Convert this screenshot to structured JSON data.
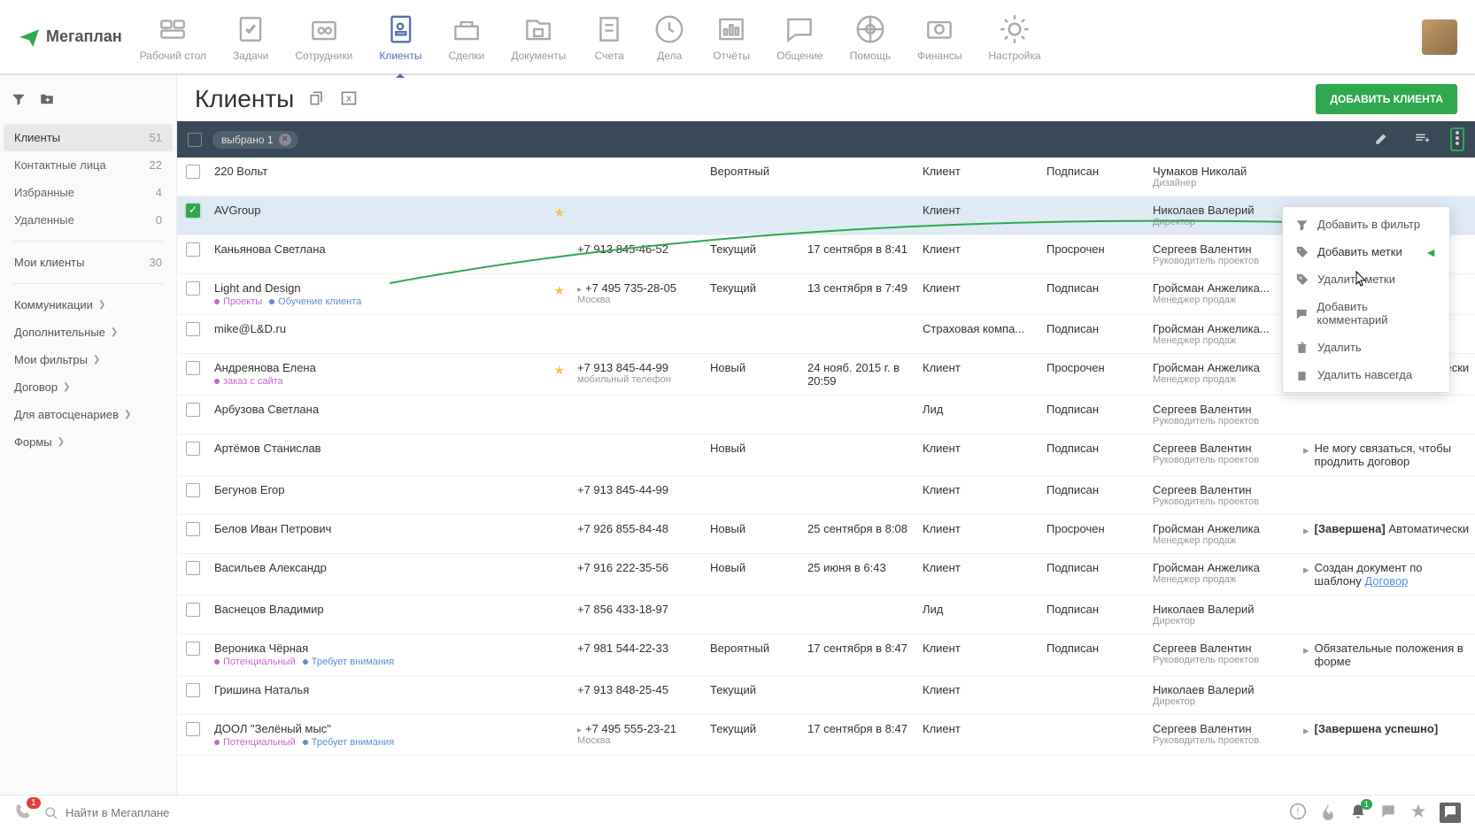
{
  "brand": "Мегаплан",
  "nav": [
    {
      "label": "Рабочий стол",
      "active": false
    },
    {
      "label": "Задачи",
      "active": false
    },
    {
      "label": "Сотрудники",
      "active": false
    },
    {
      "label": "Клиенты",
      "active": true
    },
    {
      "label": "Сделки",
      "active": false
    },
    {
      "label": "Документы",
      "active": false
    },
    {
      "label": "Счета",
      "active": false
    },
    {
      "label": "Дела",
      "active": false
    },
    {
      "label": "Отчёты",
      "active": false
    },
    {
      "label": "Общение",
      "active": false
    },
    {
      "label": "Помощь",
      "active": false
    },
    {
      "label": "Финансы",
      "active": false
    },
    {
      "label": "Настройка",
      "active": false
    }
  ],
  "sidebar": {
    "filters": [
      {
        "label": "Клиенты",
        "count": "51",
        "active": true
      },
      {
        "label": "Контактные лица",
        "count": "22",
        "active": false
      },
      {
        "label": "Избранные",
        "count": "4",
        "active": false
      },
      {
        "label": "Удаленные",
        "count": "0",
        "active": false
      }
    ],
    "sections": [
      {
        "label": "Мои клиенты",
        "count": "30"
      },
      {
        "label": "Коммуникации"
      },
      {
        "label": "Дополнительные"
      },
      {
        "label": "Мои фильтры"
      },
      {
        "label": "Договор"
      },
      {
        "label": "Для автосценариев"
      },
      {
        "label": "Формы"
      }
    ]
  },
  "page": {
    "title": "Клиенты",
    "add_button": "Добавить клиента"
  },
  "selection": {
    "chip_label": "выбрано 1"
  },
  "dropdown": {
    "items": [
      {
        "label": "Добавить в фильтр",
        "icon": "filter"
      },
      {
        "label": "Добавить метки",
        "icon": "tag",
        "highlight": true
      },
      {
        "label": "Удалить метки",
        "icon": "tag-remove"
      },
      {
        "label": "Добавить комментарий",
        "icon": "comment"
      },
      {
        "label": "Удалить",
        "icon": "trash"
      },
      {
        "label": "Удалить навсегда",
        "icon": "trash-x"
      }
    ]
  },
  "rows": [
    {
      "checked": false,
      "name": "220 Вольт",
      "star": false,
      "tags": [],
      "phone": "",
      "phonesub": "",
      "status": "Вероятный",
      "date": "",
      "type": "Клиент",
      "contract": "Подписан",
      "manager": "Чумаков Николай",
      "role": "Дизайнер",
      "extra": ""
    },
    {
      "checked": true,
      "name": "AVGroup",
      "star": true,
      "tags": [],
      "phone": "",
      "phonesub": "",
      "status": "",
      "date": "",
      "type": "Клиент",
      "contract": "",
      "manager": "Николаев Валерий",
      "role": "Директор",
      "extra": ""
    },
    {
      "checked": false,
      "name": "Каньянова Светлана",
      "star": false,
      "tags": [],
      "phone": "+7 913 845-46-52",
      "phonesub": "",
      "status": "Текущий",
      "date": "17 сентября в 8:41",
      "type": "Клиент",
      "contract": "Просрочен",
      "manager": "Сергеев Валентин",
      "role": "Руководитель проектов",
      "extra": ""
    },
    {
      "checked": false,
      "name": "Light and Design",
      "star": true,
      "tags": [
        {
          "color": "#c666d6",
          "text": "Проекты"
        },
        {
          "color": "#5b8dd6",
          "text": "Обучение клиента"
        }
      ],
      "phone": "+7 495 735-28-05",
      "phonesub": "Москва",
      "phonearrow": true,
      "status": "Текущий",
      "date": "13 сентября в 7:49",
      "type": "Клиент",
      "contract": "Подписан",
      "manager": "Гройсман Анжелика...",
      "manager_cut": true,
      "role": "Менеджер продаж",
      "extra": ""
    },
    {
      "checked": false,
      "name": "mike@L&D.ru",
      "star": false,
      "tags": [],
      "phone": "",
      "phonesub": "",
      "status": "",
      "date": "",
      "type": "Страховая компа...",
      "contract": "Подписан",
      "manager": "Гройсман Анжелика...",
      "manager_cut": true,
      "role": "Менеджер продаж",
      "extra": ""
    },
    {
      "checked": false,
      "name": "Андреянова Елена",
      "star": true,
      "tags": [
        {
          "color": "#c666d6",
          "text": "заказ с сайта"
        }
      ],
      "phone": "+7 913 845-44-99",
      "phonesub": "мобильный телефон",
      "status": "Новый",
      "date": "24 нояб. 2015 г. в 20:59",
      "type": "Клиент",
      "contract": "Просрочен",
      "manager": "Гройсман Анжелика",
      "role": "Менеджер продаж",
      "extra": "[Завершена] Автоматически",
      "extra_bold": "[Завершена]"
    },
    {
      "checked": false,
      "name": "Арбузова Светлана",
      "star": false,
      "tags": [],
      "phone": "",
      "phonesub": "",
      "status": "",
      "date": "",
      "type": "Лид",
      "contract": "Подписан",
      "manager": "Сергеев Валентин",
      "role": "Руководитель проектов",
      "extra": ""
    },
    {
      "checked": false,
      "name": "Артёмов Станислав",
      "star": false,
      "tags": [],
      "phone": "",
      "phonesub": "",
      "status": "Новый",
      "date": "",
      "type": "Клиент",
      "contract": "Подписан",
      "manager": "Сергеев Валентин",
      "role": "Руководитель проектов",
      "extra": "Не могу связаться, чтобы продлить договор"
    },
    {
      "checked": false,
      "name": "Бегунов Егор",
      "star": false,
      "tags": [],
      "phone": "+7 913 845-44-99",
      "phonesub": "",
      "status": "",
      "date": "",
      "type": "Клиент",
      "contract": "Подписан",
      "manager": "Сергеев Валентин",
      "role": "Руководитель проектов",
      "extra": ""
    },
    {
      "checked": false,
      "name": "Белов Иван Петрович",
      "star": false,
      "tags": [],
      "phone": "+7 926 855-84-48",
      "phonesub": "",
      "status": "Новый",
      "date": "25 сентября в 8:08",
      "type": "Клиент",
      "contract": "Просрочен",
      "manager": "Гройсман Анжелика",
      "role": "Менеджер продаж",
      "extra": "[Завершена] Автоматически",
      "extra_bold": "[Завершена]"
    },
    {
      "checked": false,
      "name": "Васильев Александр",
      "star": false,
      "tags": [],
      "phone": "+7 916 222-35-56",
      "phonesub": "",
      "status": "Новый",
      "date": "25 июня в 6:43",
      "type": "Клиент",
      "contract": "Подписан",
      "manager": "Гройсман Анжелика",
      "role": "Менеджер продаж",
      "extra": "Создан документ по шаблону ",
      "extra_link": "Договор"
    },
    {
      "checked": false,
      "name": "Васнецов Владимир",
      "star": false,
      "tags": [],
      "phone": "+7 856 433-18-97",
      "phonesub": "",
      "status": "",
      "date": "",
      "type": "Лид",
      "contract": "Подписан",
      "manager": "Николаев Валерий",
      "role": "Директор",
      "extra": ""
    },
    {
      "checked": false,
      "name": "Вероника Чёрная",
      "star": false,
      "tags": [
        {
          "color": "#c666d6",
          "text": "Потенциальный"
        },
        {
          "color": "#5b8dd6",
          "text": "Требует внимания"
        }
      ],
      "phone": "+7 981 544-22-33",
      "phonesub": "",
      "status": "Вероятный",
      "date": "17 сентября в 8:47",
      "type": "Клиент",
      "contract": "Подписан",
      "manager": "Сергеев Валентин",
      "role": "Руководитель проектов",
      "extra": "Обязательные положения в форме"
    },
    {
      "checked": false,
      "name": "Гришина Наталья",
      "star": false,
      "tags": [],
      "phone": "+7 913 848-25-45",
      "phonesub": "",
      "status": "Текущий",
      "date": "",
      "type": "Клиент",
      "contract": "",
      "manager": "Николаев Валерий",
      "role": "Директор",
      "extra": ""
    },
    {
      "checked": false,
      "name": "ДООЛ \"Зелёный мыс\"",
      "star": false,
      "tags": [
        {
          "color": "#c666d6",
          "text": "Потенциальный"
        },
        {
          "color": "#5b8dd6",
          "text": "Требует внимания"
        }
      ],
      "phone": "+7 495 555-23-21",
      "phonesub": "Москва",
      "phonearrow": true,
      "status": "Текущий",
      "date": "17 сентября в 8:47",
      "type": "Клиент",
      "contract": "",
      "manager": "Сергеев Валентин",
      "role": "Руководитель проектов",
      "extra": "[Завершена успешно]",
      "extra_bold": "[Завершена успешно]"
    }
  ],
  "bottom": {
    "phone_badge": "1",
    "search_placeholder": "Найти в Мегаплане",
    "bell_badge": "1"
  }
}
